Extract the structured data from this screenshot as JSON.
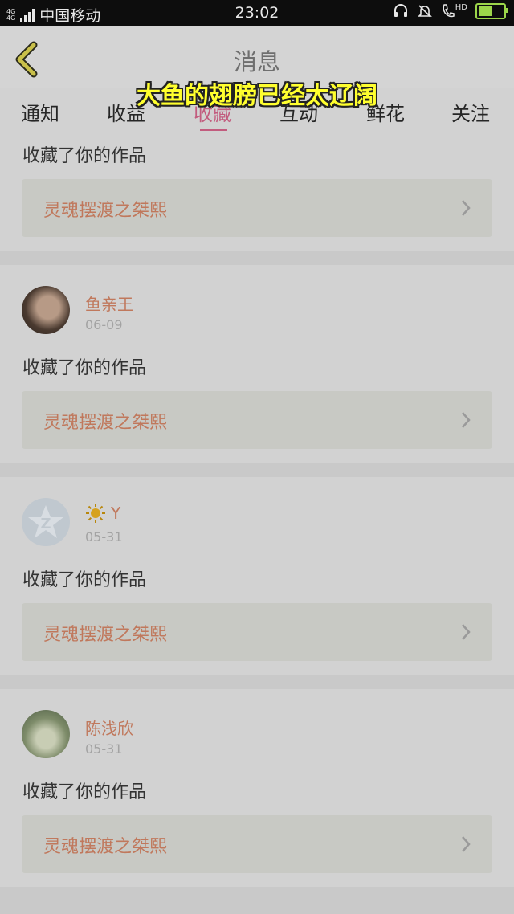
{
  "status_bar": {
    "network": "4G",
    "carrier": "中国移动",
    "time": "23:02",
    "hd": "HD",
    "battery_level": 0.55,
    "icons": [
      "signal-icon",
      "headset-icon",
      "bell-muted-icon",
      "call-icon",
      "battery-icon"
    ]
  },
  "header": {
    "title": "消息",
    "back_icon": "chevron-left-icon"
  },
  "caption": "大鱼的翅膀已经太辽阔",
  "tabs": [
    {
      "label": "通知"
    },
    {
      "label": "收益"
    },
    {
      "label": "收藏",
      "active": true
    },
    {
      "label": "互动"
    },
    {
      "label": "鲜花"
    },
    {
      "label": "关注"
    }
  ],
  "messages": [
    {
      "user": "",
      "date": "",
      "action": "收藏了你的作品",
      "work": "灵魂摆渡之桀熙"
    },
    {
      "user": "鱼亲王",
      "date": "06-09",
      "action": "收藏了你的作品",
      "work": "灵魂摆渡之桀熙"
    },
    {
      "user": "Y",
      "date": "05-31",
      "action": "收藏了你的作品",
      "work": "灵魂摆渡之桀熙"
    },
    {
      "user": "陈浅欣",
      "date": "05-31",
      "action": "收藏了你的作品",
      "work": "灵魂摆渡之桀熙"
    }
  ],
  "colors": {
    "accent": "#c25c7e",
    "username": "#c0785c",
    "caption": "#ffff2e"
  }
}
